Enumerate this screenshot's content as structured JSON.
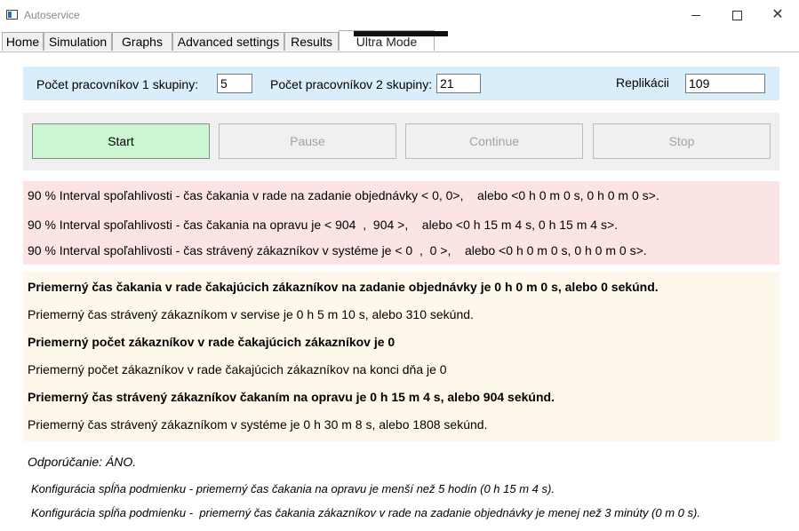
{
  "window": {
    "title": "Autoservice"
  },
  "tabs": [
    {
      "label": "Home"
    },
    {
      "label": "Simulation"
    },
    {
      "label": "Graphs"
    },
    {
      "label": "Advanced settings"
    },
    {
      "label": "Results"
    },
    {
      "label": "Ultra Mode"
    }
  ],
  "config": {
    "group1_label": "Počet pracovníkov 1 skupiny:",
    "group1_value": "5",
    "group2_label": "Počet pracovníkov 2 skupiny:",
    "group2_value": "21",
    "replications_label": "Replikácii",
    "replications_value": "109"
  },
  "controls": {
    "start": "Start",
    "pause": "Pause",
    "continue": "Continue",
    "stop": "Stop"
  },
  "intervals": [
    "90 % Interval spoľahlivosti - čas čakania v rade na zadanie objednávky < 0, 0>,    alebo <0 h 0 m 0 s, 0 h 0 m 0 s>.",
    "90 % Interval spoľahlivosti - čas čakania na opravu je < 904  ,  904 >,    alebo <0 h 15 m 4 s, 0 h 15 m 4 s>.",
    "90 % Interval spoľahlivosti - čas strávený zákazníkov v systéme je < 0  ,  0 >,    alebo <0 h 0 m 0 s, 0 h 0 m 0 s>."
  ],
  "stats": [
    "Priemerný čas čakania v rade čakajúcich zákazníkov na zadanie objednávky je 0 h 0 m 0 s, alebo 0 sekúnd.",
    "Priemerný čas strávený zákazníkom v servise je 0 h 5 m 10 s, alebo 310 sekúnd.",
    "Priemerný počet zákazníkov v rade čakajúcich zákazníkov je 0",
    "Priemerný počet zákazníkov v rade čakajúcich zákazníkov na konci dňa je 0",
    "Priemerný čas strávený zákazníkov čakaním na opravu je 0 h 15 m 4 s, alebo 904 sekúnd.",
    "Priemerný čas strávený zákazníkom v systéme je 0 h 30 m 8 s, alebo 1808 sekúnd."
  ],
  "recommendation": {
    "title": "Odporúčanie: ÁNO.",
    "line1": "Konfigurácia spĺňa podmienku - priemerný čas čakania na opravu je menší než 5 hodín (0 h 15 m 4 s).",
    "line2": "Konfigurácia spĺňa podmienku -  priemerný čas čakania zákazníkov v rade na zadanie objednávky je menej než 3 minúty (0 m 0 s)."
  },
  "colors": {
    "config_bg": "#d9eefa",
    "controls_bg": "#f0f0f0",
    "start_bg": "#ccf5d2",
    "interval_bg": "#fce4e4",
    "stats_bg": "#fef7eb"
  },
  "icons": {
    "app": "app-window-icon",
    "minimize": "minimize-icon",
    "maximize": "maximize-icon",
    "close": "close-icon"
  }
}
